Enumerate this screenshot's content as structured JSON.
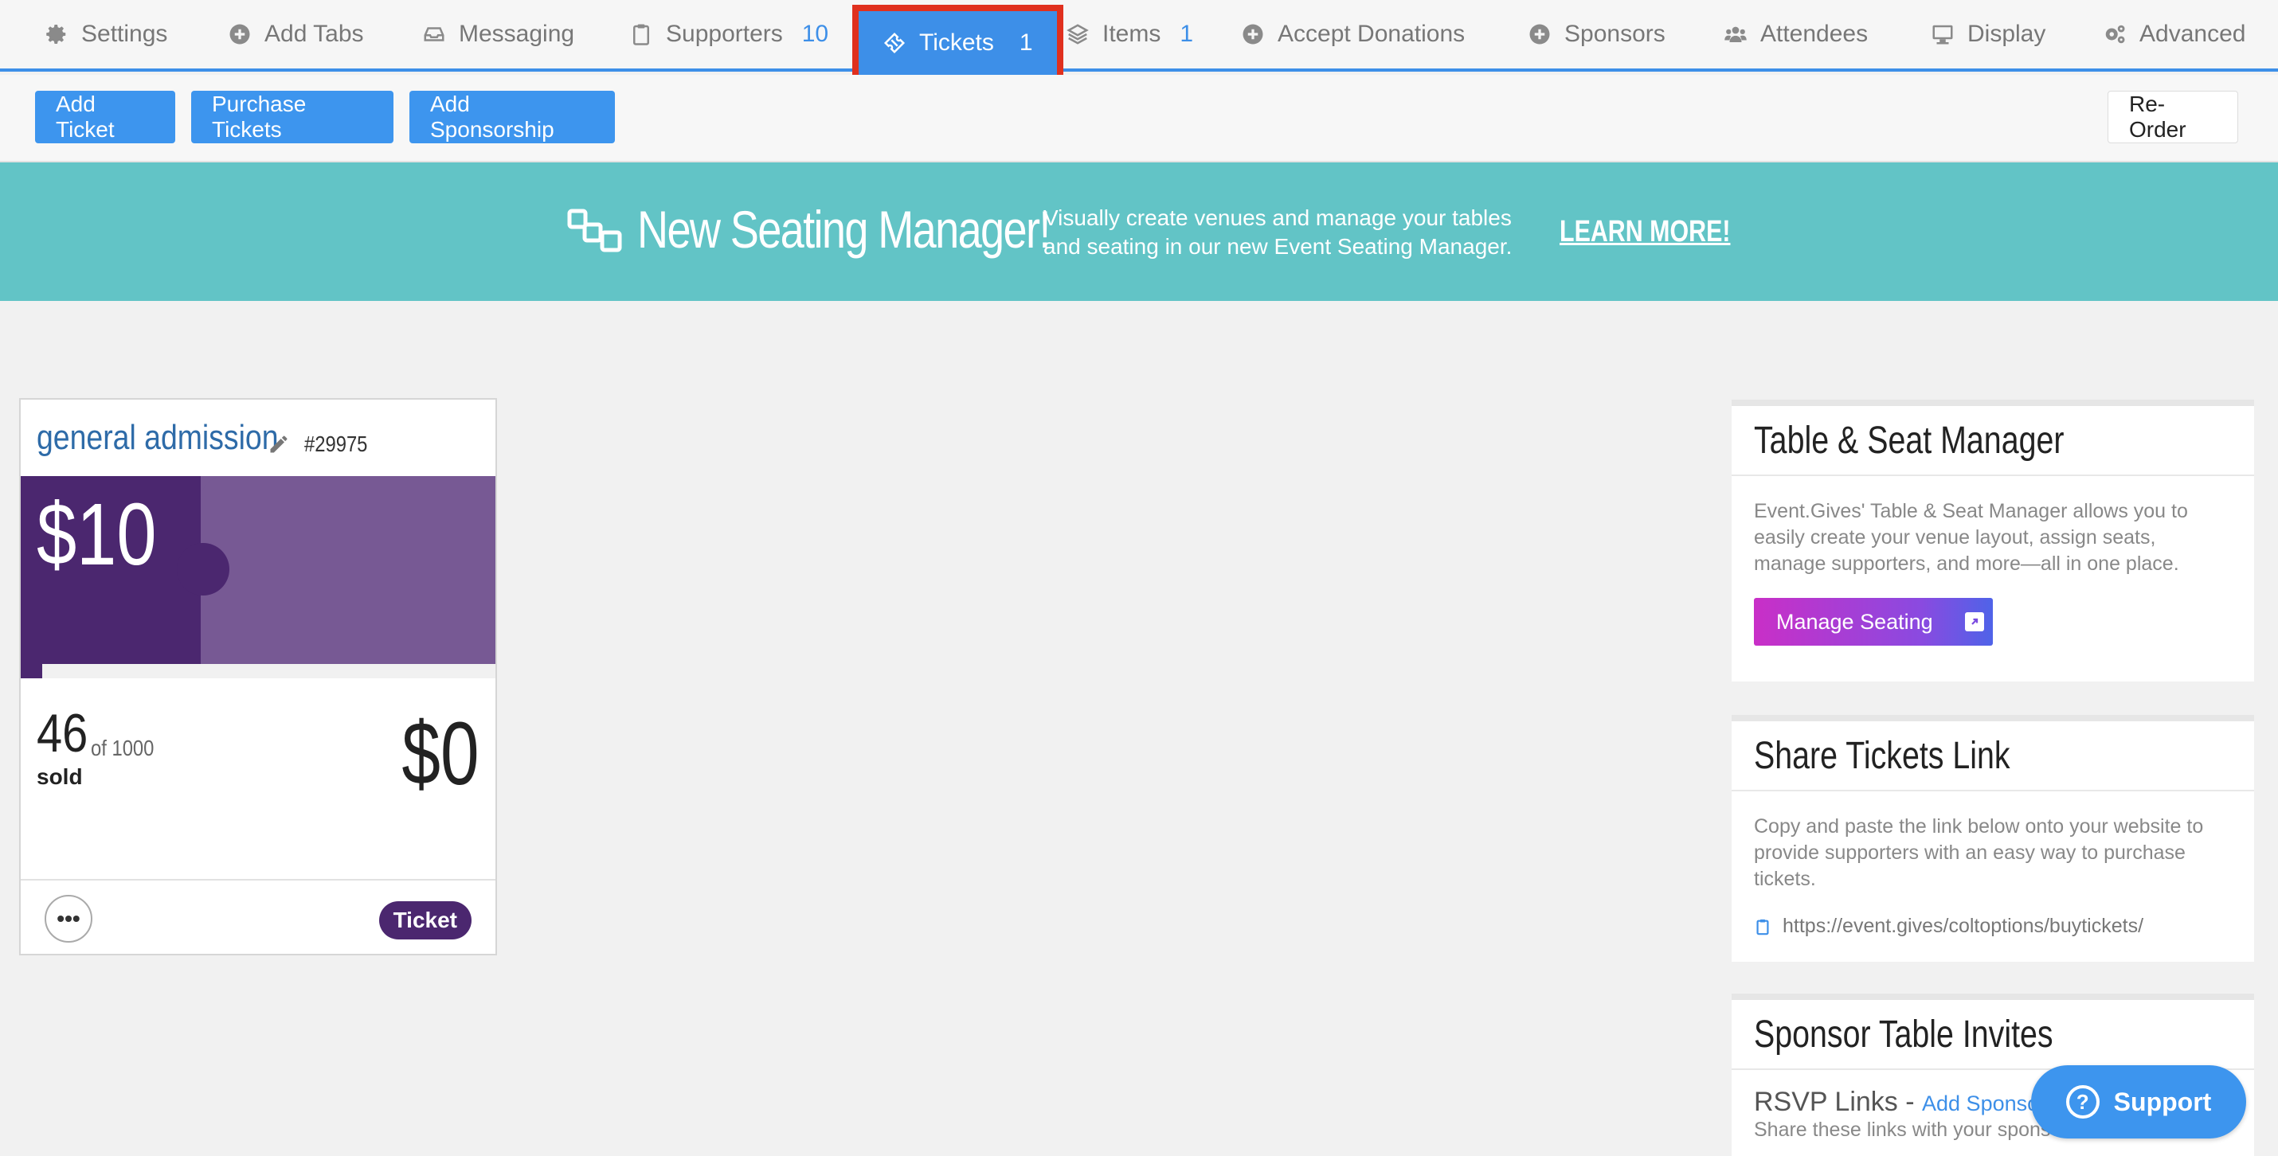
{
  "tabs": [
    {
      "label": "Settings",
      "icon": "gear-icon",
      "count": ""
    },
    {
      "label": "Add Tabs",
      "icon": "plus-circle-icon",
      "count": ""
    },
    {
      "label": "Messaging",
      "icon": "inbox-icon",
      "count": ""
    },
    {
      "label": "Supporters",
      "icon": "clipboard-icon",
      "count": "10"
    },
    {
      "label": "Tickets",
      "icon": "ticket-icon",
      "count": "1"
    },
    {
      "label": "Items",
      "icon": "layers-icon",
      "count": "1"
    },
    {
      "label": "Accept Donations",
      "icon": "plus-circle-icon",
      "count": ""
    },
    {
      "label": "Sponsors",
      "icon": "plus-circle-icon",
      "count": ""
    },
    {
      "label": "Attendees",
      "icon": "users-icon",
      "count": ""
    },
    {
      "label": "Display",
      "icon": "monitor-icon",
      "count": ""
    },
    {
      "label": "Advanced",
      "icon": "gears-icon",
      "count": ""
    }
  ],
  "toolbar": {
    "add_ticket": "Add Ticket",
    "purchase_tickets": "Purchase Tickets",
    "add_sponsorship": "Add Sponsorship",
    "reorder": "Re-Order"
  },
  "banner": {
    "title": "New Seating Manager!",
    "line1": "Visually create venues and manage your tables",
    "line2": "and seating in our new Event Seating Manager.",
    "link": "LEARN MORE!",
    "accent_color": "#62c4c6"
  },
  "ticket": {
    "name": "general admission",
    "id": "#29975",
    "price": "$10",
    "sold": "46",
    "of_total": "of 1000",
    "sold_label": "sold",
    "sold_fraction": 0.046,
    "revenue": "$0",
    "more": "•••",
    "type": "Ticket",
    "color": "#4b276f"
  },
  "panels": {
    "seat": {
      "title": "Table & Seat Manager",
      "description": "Event.Gives' Table & Seat Manager allows you to easily create your venue layout, assign seats, manage supporters, and more—all in one place.",
      "button": "Manage Seating"
    },
    "share": {
      "title": "Share Tickets Link",
      "description": "Copy and paste the link below onto your website to provide supporters with an easy way to purchase tickets.",
      "url": "https://event.gives/coltoptions/buytickets/"
    },
    "sponsor": {
      "title": "Sponsor Table Invites",
      "rsvp_label": "RSVP Links - ",
      "rsvp_link": "Add Sponsor",
      "description": "Share these links with your sponsors to allow them"
    }
  },
  "support": {
    "label": "Support"
  }
}
